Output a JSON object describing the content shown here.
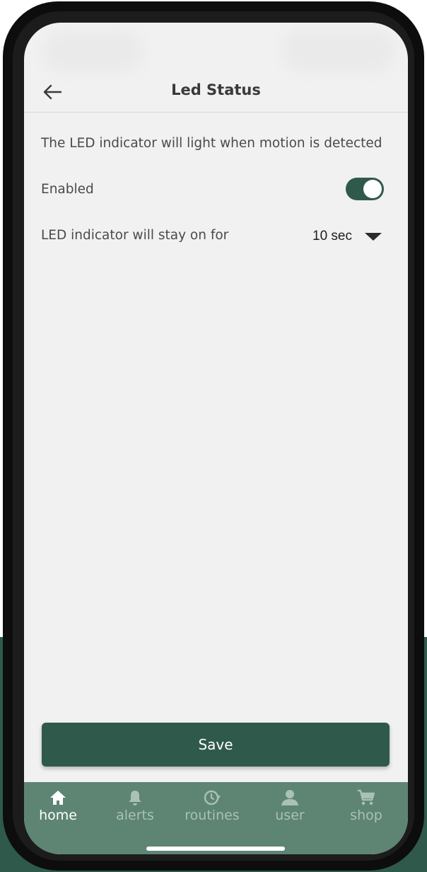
{
  "header": {
    "title": "Led Status",
    "back_icon": "arrow-left-icon"
  },
  "content": {
    "description": "The LED indicator will light when motion is detected",
    "enabled_label": "Enabled",
    "enabled": true,
    "stay_on_label": "LED indicator will stay on for",
    "stay_on_value": "10 sec"
  },
  "save_label": "Save",
  "tabs": [
    {
      "label": "home",
      "icon": "home-icon",
      "active": true
    },
    {
      "label": "alerts",
      "icon": "bell-icon",
      "active": false
    },
    {
      "label": "routines",
      "icon": "clock-refresh-icon",
      "active": false
    },
    {
      "label": "user",
      "icon": "user-icon",
      "active": false
    },
    {
      "label": "shop",
      "icon": "cart-icon",
      "active": false
    }
  ],
  "colors": {
    "accent": "#2f5a4b",
    "tabbar": "#5e8474",
    "inactive_tab": "#a9c1b7",
    "background": "#f1f1f1"
  }
}
